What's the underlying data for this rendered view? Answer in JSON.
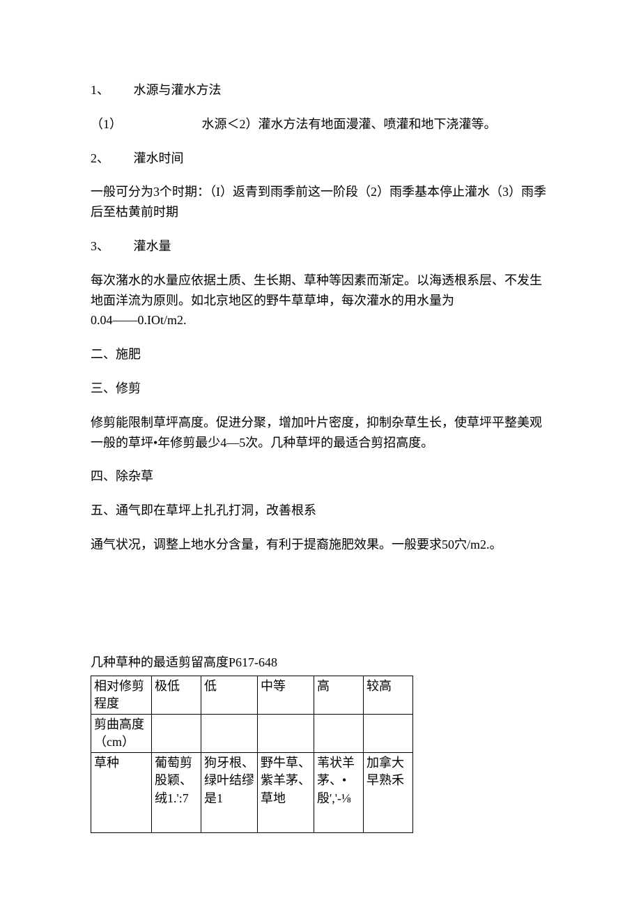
{
  "s1": {
    "num": "1、",
    "title": "水源与灌水方法",
    "sub": {
      "label": "（1）",
      "text": "水源＜2）灌水方法有地面漫灌、喷灌和地下浇灌等。"
    }
  },
  "s2": {
    "num": "2、",
    "title": "灌水时间",
    "body": "一般可分为3个时期：（I）返青到雨季前这一阶段（2）雨季基本停止灌水（3）雨季后至枯黄前时期"
  },
  "s3": {
    "num": "3、",
    "title": "灌水量",
    "body1": "每次潴水的水量应依据土质、生长期、草种等因素而渐定。以海透根系层、不发生地面洋流为原则。如北京地区的野牛草草坤，每次灌水的用水量为",
    "body2": "0.04——0.IOt/m2."
  },
  "s4": "二、施肥",
  "s5": "三、修剪",
  "s5body": "修剪能限制草坪高度。促进分聚，增加叶片密度，抑制杂草生长，使草坪平整美观一般的草坪•年修剪最少4—5次。几种草坪的最适合剪招高度。",
  "s6": "四、除杂草",
  "s7": "五、通气即在草坪上扎孔打洞，改善根系",
  "s7body": "通气状况，调整上地水分含量，有利于提裔施肥效果。一般要求50穴/m2.。",
  "table": {
    "caption": "几种草种的最适剪留高度P617-648",
    "rows": [
      [
        "相对修剪程度",
        "极低",
        "低",
        "中等",
        "高",
        "较高"
      ],
      [
        "剪曲高度（cm）",
        "",
        "",
        "",
        "",
        ""
      ],
      [
        "草种",
        "葡萄剪股颖、绒1.':7",
        "狗牙根、绿叶结缪是1",
        "野牛草、紫羊茅、草地",
        "苇状羊茅、•殷','-⅛",
        "加拿大早熟禾"
      ]
    ]
  }
}
